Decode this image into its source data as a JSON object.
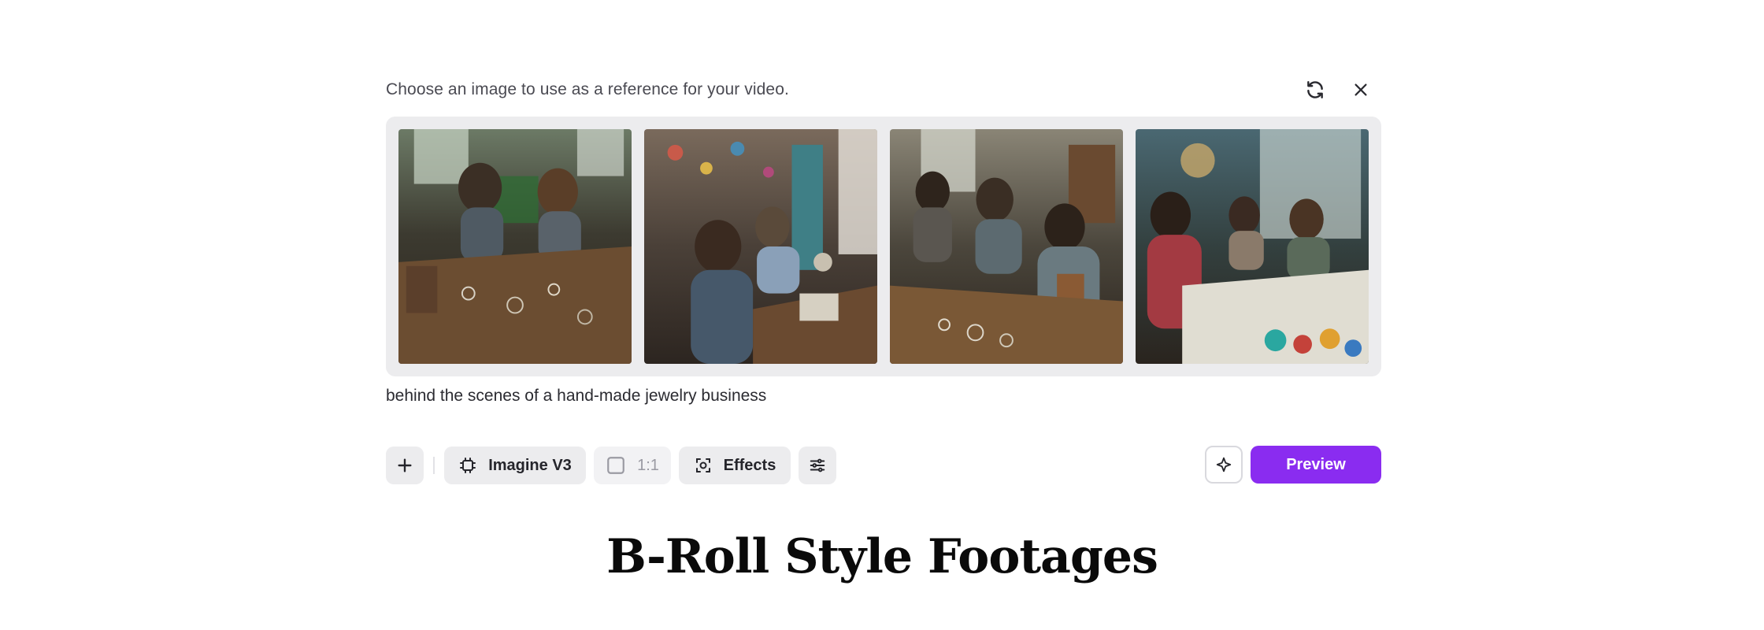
{
  "panel": {
    "hint": "Choose an image to use as a reference for your video.",
    "prompt": "behind the scenes of a hand-made jewelry business",
    "header_icons": [
      "refresh-icon",
      "close-icon"
    ]
  },
  "gallery": {
    "images": [
      {
        "label": "Two artisans making jewelry at wooden table"
      },
      {
        "label": "Women beading jewelry in colorful studio"
      },
      {
        "label": "Craftspeople working on metal jewelry"
      },
      {
        "label": "Artisans assembling jewelry near window"
      }
    ]
  },
  "toolbar": {
    "add_icon": "plus-icon",
    "model_label": "Imagine V3",
    "model_icon": "chip-icon",
    "ratio_label": "1:1",
    "ratio_icon": "square-icon",
    "effects_label": "Effects",
    "effects_icon": "effects-icon",
    "settings_icon": "sliders-icon",
    "enhance_icon": "sparkle-icon",
    "preview_label": "Preview"
  },
  "colors": {
    "accent": "#8a2cf0",
    "panel_bg": "#ececee"
  },
  "section": {
    "title": "B-Roll Style Footages"
  }
}
